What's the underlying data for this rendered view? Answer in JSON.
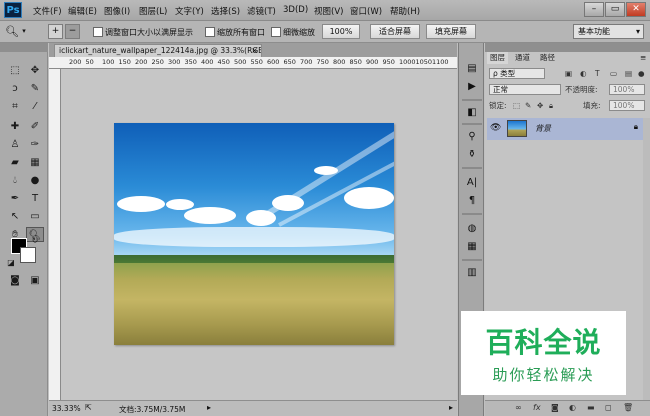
{
  "app": {
    "logo": "Ps"
  },
  "menu": [
    "文件(F)",
    "编辑(E)",
    "图像(I)",
    "图层(L)",
    "文字(Y)",
    "选择(S)",
    "滤镜(T)",
    "3D(D)",
    "视图(V)",
    "窗口(W)",
    "帮助(H)"
  ],
  "window_buttons": {
    "minimize": "–",
    "restore": "▭",
    "close": "✕"
  },
  "options_bar": {
    "resize_windows_label": "调整窗口大小以满屏显示",
    "zoom_all_label": "缩放所有窗口",
    "scrubby_zoom_label": "细微缩放",
    "zoom_percent": "100%",
    "fit_screen": "适合屏幕",
    "fill_screen": "填充屏幕",
    "workspace": "基本功能"
  },
  "document": {
    "tab_title": "iclickart_nature_wallpaper_122414a.jpg @ 33.3%(RGB/8#)",
    "tab_close": "×",
    "ruler_ticks": [
      "200",
      "50",
      "100",
      "150",
      "200",
      "250",
      "300",
      "350",
      "400",
      "450",
      "500",
      "550",
      "600",
      "650",
      "700",
      "750",
      "800",
      "850",
      "900",
      "950",
      "1000",
      "1050",
      "1100",
      "1150"
    ]
  },
  "status": {
    "zoom": "33.33%",
    "doc_info": "文档:3.75M/3.75M"
  },
  "layers_panel": {
    "tabs": [
      "图层",
      "通道",
      "路径"
    ],
    "filter_kind": "ρ 类型",
    "blend_mode": "正常",
    "opacity_label": "不透明度:",
    "opacity_value": "100%",
    "lock_label": "锁定:",
    "fill_label": "填充:",
    "fill_value": "100%",
    "layers": [
      {
        "name": "背景",
        "visible": true,
        "locked": true
      }
    ],
    "bottom_icons": [
      "link-icon",
      "fx-icon",
      "mask-icon",
      "adjustment-icon",
      "folder-icon",
      "new-layer-icon",
      "trash-icon"
    ]
  },
  "watermark": {
    "title": "百科全说",
    "subtitle": "助你轻松解决"
  },
  "colors": {
    "foreground": "#000000",
    "background": "#ffffff",
    "selected_layer": "#aab6d4",
    "watermark_green": "#1fae5a"
  }
}
